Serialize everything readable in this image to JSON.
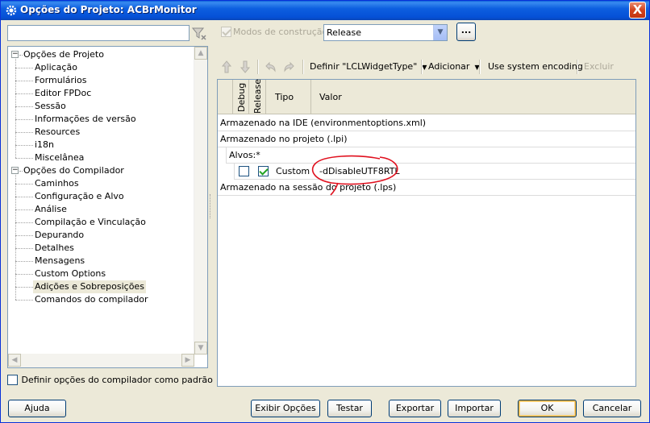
{
  "window": {
    "title": "Opções do Projeto: ACBrMonitor",
    "close_glyph": "X"
  },
  "left": {
    "filter_placeholder": "",
    "tree": [
      {
        "label": "Opções de Projeto",
        "level": 0,
        "expander": "−"
      },
      {
        "label": "Aplicação",
        "level": 1
      },
      {
        "label": "Formulários",
        "level": 1
      },
      {
        "label": "Editor FPDoc",
        "level": 1
      },
      {
        "label": "Sessão",
        "level": 1
      },
      {
        "label": "Informações de versão",
        "level": 1
      },
      {
        "label": "Resources",
        "level": 1
      },
      {
        "label": "i18n",
        "level": 1
      },
      {
        "label": "Miscelânea",
        "level": 1
      },
      {
        "label": "Opções do Compilador",
        "level": 0,
        "expander": "−"
      },
      {
        "label": "Caminhos",
        "level": 1
      },
      {
        "label": "Configuração e Alvo",
        "level": 1
      },
      {
        "label": "Análise",
        "level": 1
      },
      {
        "label": "Compilação e Vinculação",
        "level": 1
      },
      {
        "label": "Depurando",
        "level": 1
      },
      {
        "label": "Detalhes",
        "level": 1
      },
      {
        "label": "Mensagens",
        "level": 1
      },
      {
        "label": "Custom Options",
        "level": 1
      },
      {
        "label": "Adições e Sobreposições",
        "level": 1,
        "selected": true
      },
      {
        "label": "Comandos do compilador",
        "level": 1
      }
    ],
    "default_checkbox_label": "Definir opções do compilador como padrão"
  },
  "right": {
    "modes_label": "Modos de construção",
    "modes_combo_value": "Release",
    "dots_label": "...",
    "toolbar": {
      "define_label": "Definir \"LCLWidgetType\"",
      "add_label": "Adicionar",
      "encoding_label": "Use system encoding",
      "delete_label": "Excluir"
    },
    "grid": {
      "headers": {
        "debug": "Debug",
        "release": "Release",
        "type": "Tipo",
        "value": "Valor"
      },
      "rows": [
        {
          "text": "Armazenado na IDE (environmentoptions.xml)"
        },
        {
          "text": "Armazenado no projeto (.lpi)"
        },
        {
          "text": "Alvos:*"
        },
        {
          "type": "Custom",
          "value": "-dDisableUTF8RTL",
          "debug": false,
          "release": true
        },
        {
          "text": "Armazenado na sessão do projeto (.lps)"
        }
      ]
    }
  },
  "buttons": {
    "help": "Ajuda",
    "show_options": "Exibir Opções",
    "test": "Testar",
    "export": "Exportar",
    "import": "Importar",
    "ok": "OK",
    "cancel": "Cancelar"
  },
  "colors": {
    "titlebar": "#0550d6",
    "annotation": "#e0101e",
    "accent_check": "#21a121"
  }
}
